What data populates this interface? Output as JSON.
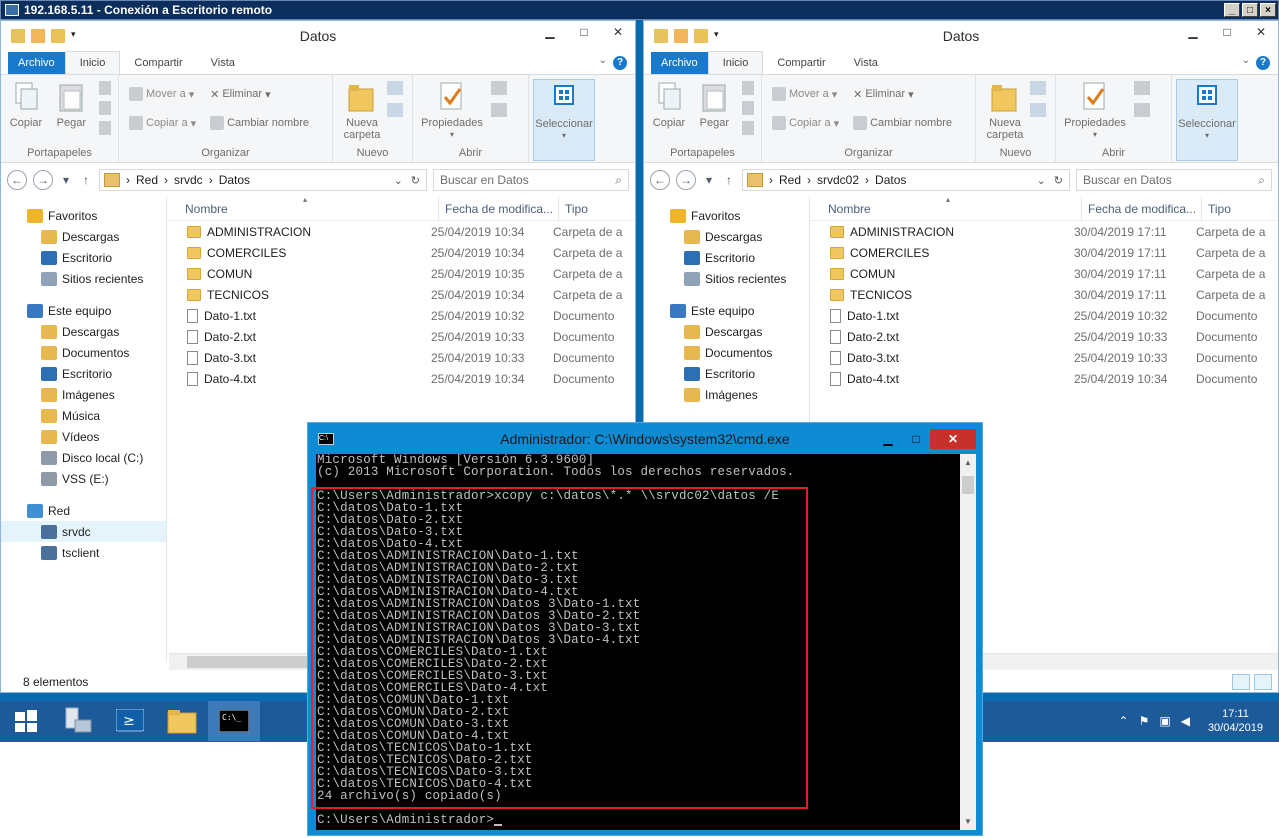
{
  "rdp": {
    "title": "192.168.5.11 - Conexión a Escritorio remoto"
  },
  "ribbon": {
    "tab_file": "Archivo",
    "tab_home": "Inicio",
    "tab_share": "Compartir",
    "tab_view": "Vista",
    "copy": "Copiar",
    "paste": "Pegar",
    "move_to": "Mover a",
    "copy_to": "Copiar a",
    "delete": "Eliminar",
    "rename": "Cambiar nombre",
    "new_folder_1": "Nueva",
    "new_folder_2": "carpeta",
    "properties": "Propiedades",
    "select": "Seleccionar",
    "grp_clipboard": "Portapapeles",
    "grp_organize": "Organizar",
    "grp_new": "Nuevo",
    "grp_open": "Abrir"
  },
  "left": {
    "title": "Datos",
    "path": [
      "Red",
      "srvdc",
      "Datos"
    ],
    "search_placeholder": "Buscar en Datos",
    "status": "8 elementos",
    "files": [
      {
        "name": "ADMINISTRACION",
        "date": "25/04/2019 10:34",
        "type": "Carpeta de a",
        "kind": "folder"
      },
      {
        "name": "COMERCILES",
        "date": "25/04/2019 10:34",
        "type": "Carpeta de a",
        "kind": "folder"
      },
      {
        "name": "COMUN",
        "date": "25/04/2019 10:35",
        "type": "Carpeta de a",
        "kind": "folder"
      },
      {
        "name": "TECNICOS",
        "date": "25/04/2019 10:34",
        "type": "Carpeta de a",
        "kind": "folder"
      },
      {
        "name": "Dato-1.txt",
        "date": "25/04/2019 10:32",
        "type": "Documento",
        "kind": "doc"
      },
      {
        "name": "Dato-2.txt",
        "date": "25/04/2019 10:33",
        "type": "Documento",
        "kind": "doc"
      },
      {
        "name": "Dato-3.txt",
        "date": "25/04/2019 10:33",
        "type": "Documento",
        "kind": "doc"
      },
      {
        "name": "Dato-4.txt",
        "date": "25/04/2019 10:34",
        "type": "Documento",
        "kind": "doc"
      }
    ],
    "tree": [
      {
        "label": "Favoritos",
        "level": "top",
        "icon": "star-icon"
      },
      {
        "label": "Descargas",
        "level": "child",
        "icon": "downloads-icon"
      },
      {
        "label": "Escritorio",
        "level": "child",
        "icon": "desktop-icon"
      },
      {
        "label": "Sitios recientes",
        "level": "child",
        "icon": "recent-icon"
      },
      {
        "label": "Este equipo",
        "level": "top",
        "icon": "computer-icon",
        "gap": true
      },
      {
        "label": "Descargas",
        "level": "child",
        "icon": "downloads-icon"
      },
      {
        "label": "Documentos",
        "level": "child",
        "icon": "documents-icon"
      },
      {
        "label": "Escritorio",
        "level": "child",
        "icon": "desktop-icon"
      },
      {
        "label": "Imágenes",
        "level": "child",
        "icon": "pictures-icon"
      },
      {
        "label": "Música",
        "level": "child",
        "icon": "music-icon"
      },
      {
        "label": "Vídeos",
        "level": "child",
        "icon": "videos-icon"
      },
      {
        "label": "Disco local (C:)",
        "level": "child",
        "icon": "drive-icon"
      },
      {
        "label": "VSS (E:)",
        "level": "child",
        "icon": "drive-icon"
      },
      {
        "label": "Red",
        "level": "top",
        "icon": "network-icon",
        "gap": true
      },
      {
        "label": "srvdc",
        "level": "child",
        "icon": "server-icon",
        "selected": true
      },
      {
        "label": "tsclient",
        "level": "child",
        "icon": "server-icon"
      }
    ]
  },
  "right": {
    "title": "Datos",
    "path": [
      "Red",
      "srvdc02",
      "Datos"
    ],
    "search_placeholder": "Buscar en Datos",
    "files": [
      {
        "name": "ADMINISTRACION",
        "date": "30/04/2019 17:11",
        "type": "Carpeta de a",
        "kind": "folder"
      },
      {
        "name": "COMERCILES",
        "date": "30/04/2019 17:11",
        "type": "Carpeta de a",
        "kind": "folder"
      },
      {
        "name": "COMUN",
        "date": "30/04/2019 17:11",
        "type": "Carpeta de a",
        "kind": "folder"
      },
      {
        "name": "TECNICOS",
        "date": "30/04/2019 17:11",
        "type": "Carpeta de a",
        "kind": "folder"
      },
      {
        "name": "Dato-1.txt",
        "date": "25/04/2019 10:32",
        "type": "Documento",
        "kind": "doc"
      },
      {
        "name": "Dato-2.txt",
        "date": "25/04/2019 10:33",
        "type": "Documento",
        "kind": "doc"
      },
      {
        "name": "Dato-3.txt",
        "date": "25/04/2019 10:33",
        "type": "Documento",
        "kind": "doc"
      },
      {
        "name": "Dato-4.txt",
        "date": "25/04/2019 10:34",
        "type": "Documento",
        "kind": "doc"
      }
    ],
    "tree": [
      {
        "label": "Favoritos",
        "level": "top",
        "icon": "star-icon"
      },
      {
        "label": "Descargas",
        "level": "child",
        "icon": "downloads-icon"
      },
      {
        "label": "Escritorio",
        "level": "child",
        "icon": "desktop-icon"
      },
      {
        "label": "Sitios recientes",
        "level": "child",
        "icon": "recent-icon"
      },
      {
        "label": "Este equipo",
        "level": "top",
        "icon": "computer-icon",
        "gap": true
      },
      {
        "label": "Descargas",
        "level": "child",
        "icon": "downloads-icon"
      },
      {
        "label": "Documentos",
        "level": "child",
        "icon": "documents-icon"
      },
      {
        "label": "Escritorio",
        "level": "child",
        "icon": "desktop-icon"
      },
      {
        "label": "Imágenes",
        "level": "child",
        "icon": "pictures-icon"
      }
    ]
  },
  "columns": {
    "name": "Nombre",
    "date": "Fecha de modifica...",
    "type": "Tipo"
  },
  "cmd": {
    "title": "Administrador: C:\\Windows\\system32\\cmd.exe",
    "icon_text": "C:\\",
    "lines": [
      "Microsoft Windows [Versión 6.3.9600]",
      "(c) 2013 Microsoft Corporation. Todos los derechos reservados.",
      "",
      "C:\\Users\\Administrador>xcopy c:\\datos\\*.* \\\\srvdc02\\datos /E",
      "C:\\datos\\Dato-1.txt",
      "C:\\datos\\Dato-2.txt",
      "C:\\datos\\Dato-3.txt",
      "C:\\datos\\Dato-4.txt",
      "C:\\datos\\ADMINISTRACION\\Dato-1.txt",
      "C:\\datos\\ADMINISTRACION\\Dato-2.txt",
      "C:\\datos\\ADMINISTRACION\\Dato-3.txt",
      "C:\\datos\\ADMINISTRACION\\Dato-4.txt",
      "C:\\datos\\ADMINISTRACION\\Datos 3\\Dato-1.txt",
      "C:\\datos\\ADMINISTRACION\\Datos 3\\Dato-2.txt",
      "C:\\datos\\ADMINISTRACION\\Datos 3\\Dato-3.txt",
      "C:\\datos\\ADMINISTRACION\\Datos 3\\Dato-4.txt",
      "C:\\datos\\COMERCILES\\Dato-1.txt",
      "C:\\datos\\COMERCILES\\Dato-2.txt",
      "C:\\datos\\COMERCILES\\Dato-3.txt",
      "C:\\datos\\COMERCILES\\Dato-4.txt",
      "C:\\datos\\COMUN\\Dato-1.txt",
      "C:\\datos\\COMUN\\Dato-2.txt",
      "C:\\datos\\COMUN\\Dato-3.txt",
      "C:\\datos\\COMUN\\Dato-4.txt",
      "C:\\datos\\TECNICOS\\Dato-1.txt",
      "C:\\datos\\TECNICOS\\Dato-2.txt",
      "C:\\datos\\TECNICOS\\Dato-3.txt",
      "C:\\datos\\TECNICOS\\Dato-4.txt",
      "24 archivo(s) copiado(s)",
      "",
      "C:\\Users\\Administrador>"
    ]
  },
  "taskbar": {
    "time": "17:11",
    "date": "30/04/2019"
  },
  "colors": {
    "accent": "#1979ca",
    "cmd_frame": "#0e8bd2",
    "highlight_box": "#e0202a",
    "taskbar": "#1d5a9a"
  }
}
